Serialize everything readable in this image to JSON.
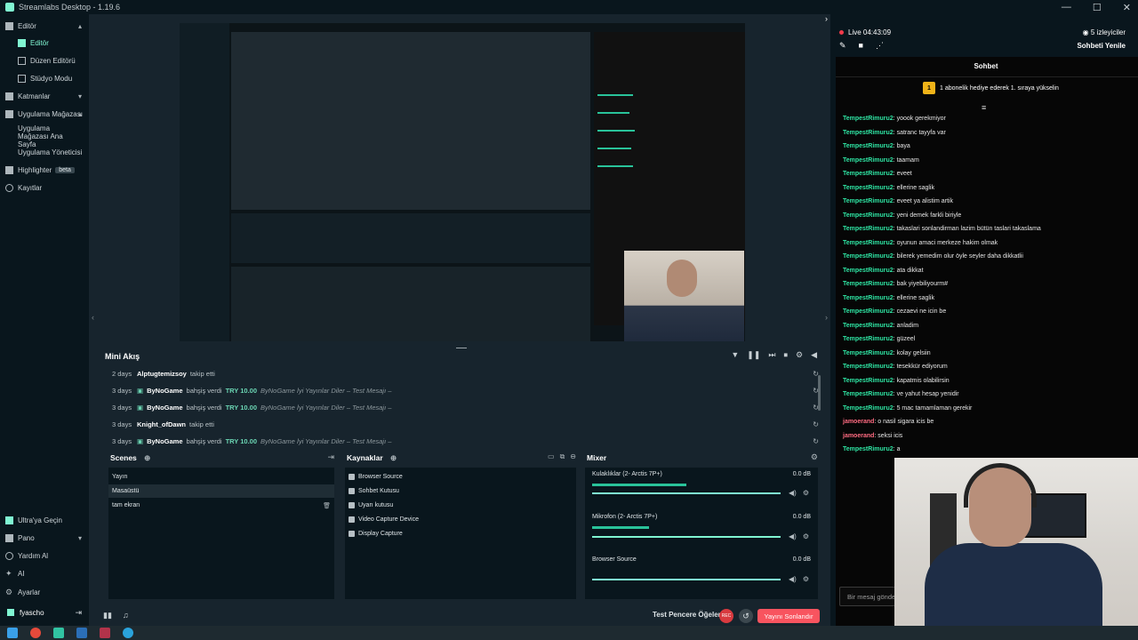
{
  "app": {
    "title": "Streamlabs Desktop - 1.19.6"
  },
  "window_controls": {
    "minimize": "—",
    "maximize": "☐",
    "close": "✕"
  },
  "nav": {
    "items": [
      {
        "label": "Editör",
        "icon": "layout-icon",
        "expanded": true
      },
      {
        "label": "Editör",
        "icon": "editor-icon",
        "active": true
      },
      {
        "label": "Düzen Editörü",
        "icon": "grid-icon"
      },
      {
        "label": "Stüdyo Modu",
        "icon": "studio-icon"
      },
      {
        "label": "Katmanlar",
        "icon": "layers-icon"
      },
      {
        "label": "Uygulama Mağazası",
        "icon": "store-icon"
      },
      {
        "label": "Uygulama Mağazası Ana Sayfa"
      },
      {
        "label": "Uygulama Yöneticisi"
      },
      {
        "label": "Highlighter",
        "badge": "beta",
        "icon": "highlighter-icon"
      },
      {
        "label": "Kayıtlar",
        "icon": "record-icon"
      }
    ],
    "bottom": [
      {
        "label": "Ultra'ya Geçin",
        "icon": "ultra-icon"
      },
      {
        "label": "Pano",
        "icon": "dashboard-icon"
      },
      {
        "label": "Yardım Al",
        "icon": "help-icon"
      },
      {
        "label": "AI",
        "icon": "ai-icon"
      },
      {
        "label": "Ayarlar",
        "icon": "gear-icon"
      }
    ],
    "profile": {
      "name": "fyascho",
      "logout_icon": "logout-icon"
    }
  },
  "minifeed": {
    "title": "Mini Akış",
    "rows": [
      {
        "when": "2 days",
        "user": "Alptugtemizsoy",
        "action": "takip etti",
        "amount": "",
        "message": ""
      },
      {
        "when": "3 days",
        "user": "ByNoGame",
        "action": "bahşiş verdi",
        "amount": "TRY 10.00",
        "message": "ByNoGame İyi Yayınlar Diler – Test Mesajı –"
      },
      {
        "when": "3 days",
        "user": "ByNoGame",
        "action": "bahşiş verdi",
        "amount": "TRY 10.00",
        "message": "ByNoGame İyi Yayınlar Diler – Test Mesajı –"
      },
      {
        "when": "3 days",
        "user": "Knight_ofDawn",
        "action": "takip etti",
        "amount": "",
        "message": ""
      },
      {
        "when": "3 days",
        "user": "ByNoGame",
        "action": "bahşiş verdi",
        "amount": "TRY 10.00",
        "message": "ByNoGame İyi Yayınlar Diler – Test Mesajı –"
      }
    ]
  },
  "scenes": {
    "title": "Scenes",
    "items": [
      "Yayın",
      "Masaüstü",
      "tam ekran"
    ],
    "selected": 1
  },
  "sources": {
    "title": "Kaynaklar",
    "items": [
      "Browser Source",
      "Sohbet Kutusu",
      "Uyarı kutusu",
      "Video Capture Device",
      "Display Capture"
    ]
  },
  "mixer": {
    "title": "Mixer",
    "channels": [
      {
        "name": "Kulaklıklar (2- Arctis 7P+)",
        "db": "0.0 dB",
        "level": 0.5,
        "volume": 1.0
      },
      {
        "name": "Mikrofon (2- Arctis 7P+)",
        "db": "0.0 dB",
        "level": 0.3,
        "volume": 1.0
      },
      {
        "name": "Browser Source",
        "db": "0.0 dB",
        "level": 0.0,
        "volume": 1.0
      }
    ]
  },
  "footer": {
    "test_widgets": "Test Pencere Öğeleri",
    "rec": "REC",
    "end_stream": "Yayını Sonlandır"
  },
  "live": {
    "status": "Live 04:43:09",
    "viewers": "5 izleyiciler",
    "refresh_chat": "Sohbeti Yenile"
  },
  "chat": {
    "title": "Sohbet",
    "subscription_banner": "1 abonelik hediye ederek 1. sıraya yükselin",
    "subscription_rank": "1",
    "messages": [
      {
        "user": "TempestRimuru2",
        "text": "yoook gerekmiyor",
        "color": "#2fe6a4"
      },
      {
        "user": "TempestRimuru2",
        "text": "satranc tayyfa var",
        "color": "#2fe6a4"
      },
      {
        "user": "TempestRimuru2",
        "text": "baya",
        "color": "#2fe6a4"
      },
      {
        "user": "TempestRimuru2",
        "text": "taamam",
        "color": "#2fe6a4"
      },
      {
        "user": "TempestRimuru2",
        "text": "eveet",
        "color": "#2fe6a4"
      },
      {
        "user": "TempestRimuru2",
        "text": "ellerine saglik",
        "color": "#2fe6a4"
      },
      {
        "user": "TempestRimuru2",
        "text": "eveet ya alistim artik",
        "color": "#2fe6a4"
      },
      {
        "user": "TempestRimuru2",
        "text": "yeni demek farkli biriyle",
        "color": "#2fe6a4"
      },
      {
        "user": "TempestRimuru2",
        "text": "takaslari sonlandirman lazim bütün taslari takaslama",
        "color": "#2fe6a4"
      },
      {
        "user": "TempestRimuru2",
        "text": "oyunun amaci merkeze hakim olmak",
        "color": "#2fe6a4"
      },
      {
        "user": "TempestRimuru2",
        "text": "bilerek yemedim olur öyle seyler daha dikkatlii",
        "color": "#2fe6a4"
      },
      {
        "user": "TempestRimuru2",
        "text": "ata dikkat",
        "color": "#2fe6a4"
      },
      {
        "user": "TempestRimuru2",
        "text": "bak yiyebiliyourm#",
        "color": "#2fe6a4"
      },
      {
        "user": "TempestRimuru2",
        "text": "ellerine saglik",
        "color": "#2fe6a4"
      },
      {
        "user": "TempestRimuru2",
        "text": "cezaevi ne icin be",
        "color": "#2fe6a4"
      },
      {
        "user": "TempestRimuru2",
        "text": "anladim",
        "color": "#2fe6a4"
      },
      {
        "user": "TempestRimuru2",
        "text": "güzeel",
        "color": "#2fe6a4"
      },
      {
        "user": "TempestRimuru2",
        "text": "kolay gelsiin",
        "color": "#2fe6a4"
      },
      {
        "user": "TempestRimuru2",
        "text": "tesekkür ediyorum",
        "color": "#2fe6a4"
      },
      {
        "user": "TempestRimuru2",
        "text": "kapatmis olabilirsin",
        "color": "#2fe6a4"
      },
      {
        "user": "TempestRimuru2",
        "text": "ve yahut hesap yenidir",
        "color": "#2fe6a4"
      },
      {
        "user": "TempestRimuru2",
        "text": "5 mac tamamlaman gerekir",
        "color": "#2fe6a4"
      },
      {
        "user": "jamoerand",
        "text": "o nasil sigara icis be",
        "color": "#ff6b81"
      },
      {
        "user": "jamoerand",
        "text": "seksi icis",
        "color": "#ff6b81"
      },
      {
        "user": "TempestRimuru2",
        "text": "a",
        "color": "#2fe6a4"
      }
    ],
    "input_placeholder": "Bir mesaj gönder"
  }
}
